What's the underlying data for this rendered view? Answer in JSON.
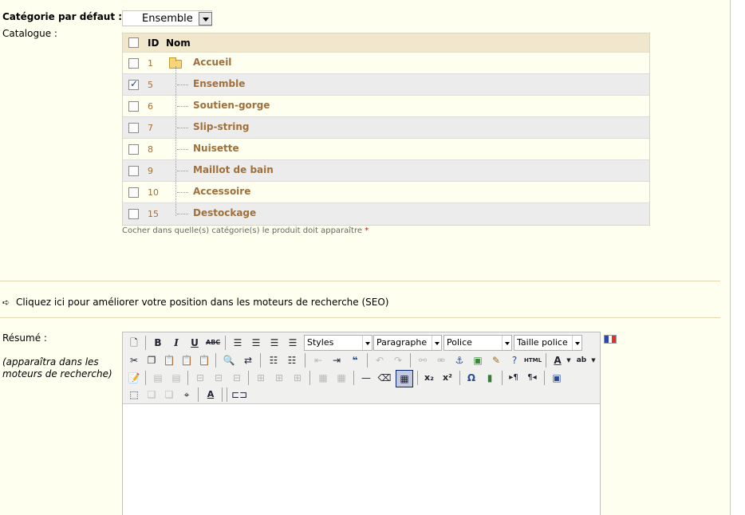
{
  "default_category": {
    "label": "Catégorie par défaut :",
    "value": "Ensemble"
  },
  "catalogue": {
    "label": "Catalogue :",
    "headers": {
      "id": "ID",
      "name": "Nom"
    },
    "rows": [
      {
        "id": "1",
        "name": "Accueil",
        "checked": false,
        "icon": "folder-icon"
      },
      {
        "id": "5",
        "name": "Ensemble",
        "checked": true
      },
      {
        "id": "6",
        "name": "Soutien-gorge",
        "checked": false
      },
      {
        "id": "7",
        "name": "Slip-string",
        "checked": false
      },
      {
        "id": "8",
        "name": "Nuisette",
        "checked": false
      },
      {
        "id": "9",
        "name": "Maillot de bain",
        "checked": false
      },
      {
        "id": "10",
        "name": "Accessoire",
        "checked": false
      },
      {
        "id": "15",
        "name": "Destockage",
        "checked": false
      }
    ],
    "hint": "Cocher dans quelle(s) catégorie(s) le produit doit apparaître",
    "required_mark": "*"
  },
  "seo_link": "Cliquez ici pour améliorer votre position dans les moteurs de recherche (SEO)",
  "summary": {
    "label": "Résumé :",
    "note": "(apparaîtra dans les moteurs de recherche)",
    "language_flag": "fr",
    "editor": {
      "selects": {
        "styles": "Styles",
        "format": "Paragraphe",
        "font": "Police",
        "size": "Taille police"
      },
      "html_button": "HTML"
    }
  },
  "colors": {
    "background": "#ffffef",
    "category_text": "#a0703c",
    "header_bg": "#f1e7cd"
  }
}
